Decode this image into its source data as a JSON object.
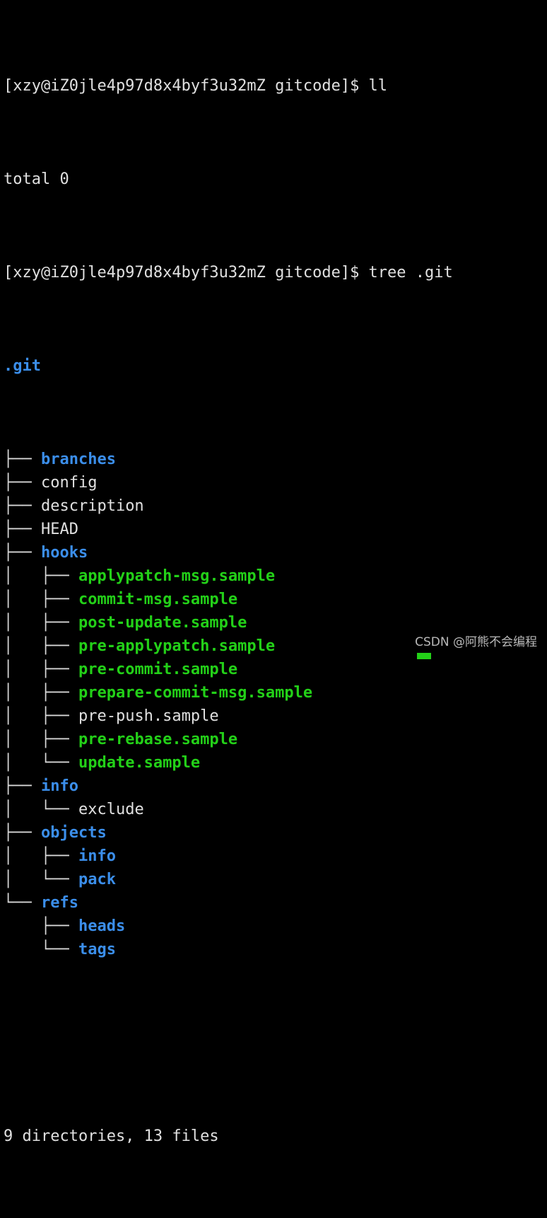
{
  "terminal": {
    "background_color": "#000000",
    "foreground_color": "#e0e0e0",
    "dir_color": "#3b8eea",
    "exec_color": "#23d018",
    "cursor_color": "#23d018",
    "prompt_line_1": "[xzy@iZ0jle4p97d8x4byf3u32mZ gitcode]$ ll",
    "output_line_1": "total 0",
    "prompt_line_2": "[xzy@iZ0jle4p97d8x4byf3u32mZ gitcode]$ tree .git",
    "root_label": ".git",
    "summary": "9 directories, 13 files",
    "watermark": "CSDN @阿熊不会编程"
  },
  "tree": [
    {
      "prefix": "├── ",
      "name": "branches",
      "kind": "dir"
    },
    {
      "prefix": "├── ",
      "name": "config",
      "kind": "file"
    },
    {
      "prefix": "├── ",
      "name": "description",
      "kind": "file"
    },
    {
      "prefix": "├── ",
      "name": "HEAD",
      "kind": "file"
    },
    {
      "prefix": "├── ",
      "name": "hooks",
      "kind": "dir"
    },
    {
      "prefix": "│   ├── ",
      "name": "applypatch-msg.sample",
      "kind": "exec"
    },
    {
      "prefix": "│   ├── ",
      "name": "commit-msg.sample",
      "kind": "exec"
    },
    {
      "prefix": "│   ├── ",
      "name": "post-update.sample",
      "kind": "exec"
    },
    {
      "prefix": "│   ├── ",
      "name": "pre-applypatch.sample",
      "kind": "exec"
    },
    {
      "prefix": "│   ├── ",
      "name": "pre-commit.sample",
      "kind": "exec"
    },
    {
      "prefix": "│   ├── ",
      "name": "prepare-commit-msg.sample",
      "kind": "exec"
    },
    {
      "prefix": "│   ├── ",
      "name": "pre-push.sample",
      "kind": "file"
    },
    {
      "prefix": "│   ├── ",
      "name": "pre-rebase.sample",
      "kind": "exec"
    },
    {
      "prefix": "│   └── ",
      "name": "update.sample",
      "kind": "exec"
    },
    {
      "prefix": "├── ",
      "name": "info",
      "kind": "dir"
    },
    {
      "prefix": "│   └── ",
      "name": "exclude",
      "kind": "file"
    },
    {
      "prefix": "├── ",
      "name": "objects",
      "kind": "dir"
    },
    {
      "prefix": "│   ├── ",
      "name": "info",
      "kind": "dir"
    },
    {
      "prefix": "│   └── ",
      "name": "pack",
      "kind": "dir"
    },
    {
      "prefix": "└── ",
      "name": "refs",
      "kind": "dir"
    },
    {
      "prefix": "    ├── ",
      "name": "heads",
      "kind": "dir"
    },
    {
      "prefix": "    └── ",
      "name": "tags",
      "kind": "dir"
    }
  ]
}
